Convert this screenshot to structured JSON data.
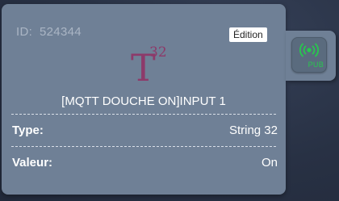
{
  "card": {
    "id_label": "ID:",
    "id_value": "524344",
    "edit_label": "Édition",
    "type_glyph": "T",
    "type_superscript": "32",
    "name": "[MQTT DOUCHE ON]INPUT 1",
    "rows": [
      {
        "label": "Type:",
        "value": "String 32"
      },
      {
        "label": "Valeur:",
        "value": "On"
      }
    ]
  },
  "pub_button": {
    "icon": "broadcast-icon",
    "label": "PUB",
    "color": "#27c94d"
  },
  "colors": {
    "card_bg": "#6f8096",
    "glyph": "#8d3a6a",
    "background": "#2a3347"
  }
}
